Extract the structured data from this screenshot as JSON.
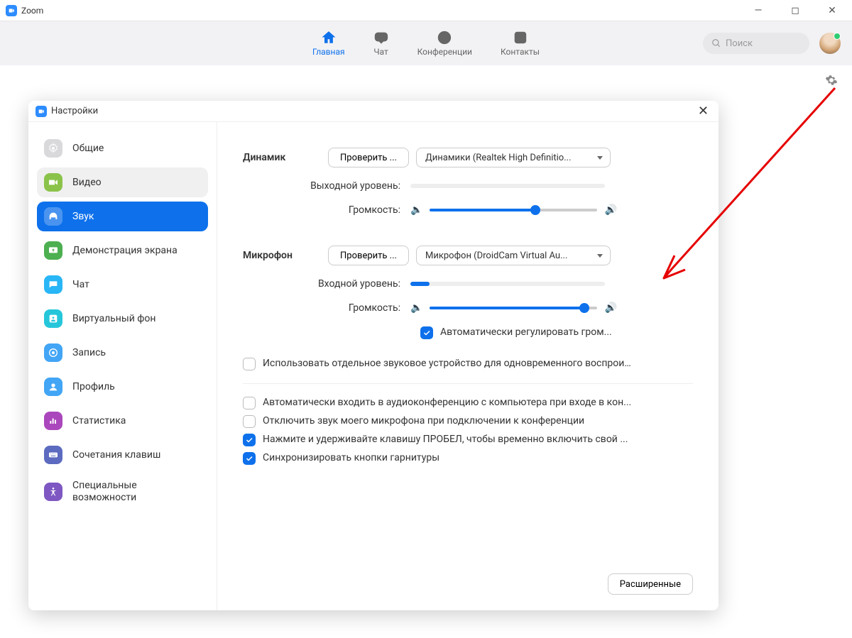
{
  "window": {
    "title": "Zoom"
  },
  "topnav": {
    "home": "Главная",
    "chat": "Чат",
    "meetings": "Конференции",
    "contacts": "Контакты",
    "search_placeholder": "Поиск"
  },
  "settings": {
    "title": "Настройки",
    "sidebar": {
      "general": "Общие",
      "video": "Видео",
      "audio": "Звук",
      "screen_share": "Демонстрация экрана",
      "chat": "Чат",
      "virtual_bg": "Виртуальный фон",
      "recording": "Запись",
      "profile": "Профиль",
      "statistics": "Статистика",
      "shortcuts": "Сочетания клавиш",
      "accessibility": "Специальные возможности"
    },
    "audio": {
      "speaker": {
        "label": "Динамик",
        "test": "Проверить ...",
        "device": "Динамики (Realtek High Definitio...",
        "output_level_label": "Выходной уровень:",
        "output_level_pct": 0,
        "volume_label": "Громкость:",
        "volume_pct": 63
      },
      "mic": {
        "label": "Микрофон",
        "test": "Проверить ...",
        "device": "Микрофон (DroidCam Virtual Au...",
        "input_level_label": "Входной уровень:",
        "input_level_pct": 10,
        "volume_label": "Громкость:",
        "volume_pct": 92
      },
      "auto_adjust": {
        "checked": true,
        "label": "Автоматически регулировать гром..."
      },
      "separate_device": {
        "checked": false,
        "label": "Использовать отдельное звуковое устройство для одновременного воспрои..."
      },
      "auto_join": {
        "checked": false,
        "label": "Автоматически входить в аудиоконференцию с компьютера при входе в кон..."
      },
      "mute_on_join": {
        "checked": false,
        "label": "Отключить звук моего микрофона при подключении к конференции"
      },
      "ptt": {
        "checked": true,
        "label": "Нажмите и удерживайте клавишу ПРОБЕЛ, чтобы временно включить свой ..."
      },
      "sync_headset": {
        "checked": true,
        "label": "Синхронизировать кнопки гарнитуры"
      },
      "advanced": "Расширенные"
    }
  }
}
